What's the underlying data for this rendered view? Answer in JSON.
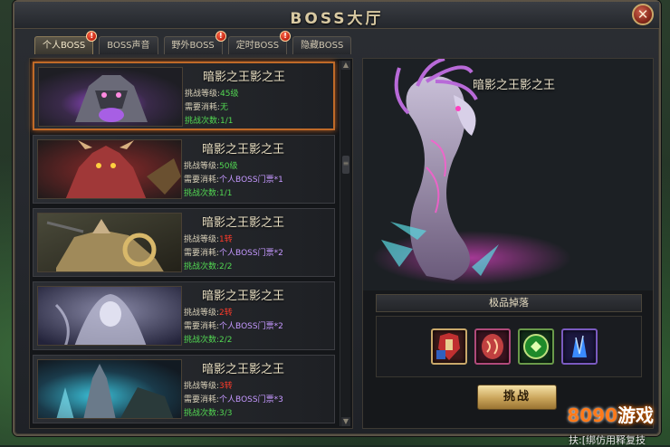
{
  "window": {
    "title": "BOSS大厅",
    "close_glyph": "✕"
  },
  "tabs": [
    {
      "label": "个人BOSS",
      "active": true,
      "badge": "!"
    },
    {
      "label": "BOSS声音",
      "active": false,
      "badge": ""
    },
    {
      "label": "野外BOSS",
      "active": false,
      "badge": "!"
    },
    {
      "label": "定时BOSS",
      "active": false,
      "badge": "!"
    },
    {
      "label": "隐藏BOSS",
      "active": false,
      "badge": ""
    }
  ],
  "boss_list": [
    {
      "name": "暗影之王影之王",
      "level_label": "挑战等级:",
      "level_value": "45级",
      "level_color": "green",
      "cost_label": "需要消耗:",
      "cost_value": "无",
      "cost_color": "green",
      "count_label": "挑战次数:",
      "count_value": "1/1",
      "selected": true,
      "portrait": "purple-demon"
    },
    {
      "name": "暗影之王影之王",
      "level_label": "挑战等级:",
      "level_value": "50级",
      "level_color": "green",
      "cost_label": "需要消耗:",
      "cost_value": "个人BOSS门票*1",
      "cost_color": "purple",
      "count_label": "挑战次数:",
      "count_value": "1/1",
      "selected": false,
      "portrait": "red-demon"
    },
    {
      "name": "暗影之王影之王",
      "level_label": "挑战等级:",
      "level_value": "1转",
      "level_color": "red",
      "cost_label": "需要消耗:",
      "cost_value": "个人BOSS门票*2",
      "cost_color": "purple",
      "count_label": "挑战次数:",
      "count_value": "2/2",
      "selected": false,
      "portrait": "golden-knight"
    },
    {
      "name": "暗影之王影之王",
      "level_label": "挑战等级:",
      "level_value": "2转",
      "level_color": "red",
      "cost_label": "需要消耗:",
      "cost_value": "个人BOSS门票*2",
      "cost_color": "purple",
      "count_label": "挑战次数:",
      "count_value": "2/2",
      "selected": false,
      "portrait": "ghost-lady"
    },
    {
      "name": "暗影之王影之王",
      "level_label": "挑战等级:",
      "level_value": "3转",
      "level_color": "red",
      "cost_label": "需要消耗:",
      "cost_value": "个人BOSS门票*3",
      "cost_color": "purple",
      "count_label": "挑战次数:",
      "count_value": "3/3",
      "selected": false,
      "portrait": "blue-knight"
    }
  ],
  "detail": {
    "boss_name": "暗影之王影之王",
    "drop_header": "极品掉落",
    "drops": [
      {
        "icon": "armor-icon",
        "border": "#c9a86a",
        "bg": "#3a1a1a"
      },
      {
        "icon": "rune-stone-icon",
        "border": "#b04a7a",
        "bg": "#3a1420"
      },
      {
        "icon": "green-orb-icon",
        "border": "#6a9a4a",
        "bg": "#12301a"
      },
      {
        "icon": "blue-crystal-icon",
        "border": "#7a5ac0",
        "bg": "#1c1840"
      }
    ],
    "challenge_label": "挑战"
  },
  "scroll": {
    "up": "▲",
    "down": "▼",
    "thumb": "≡"
  },
  "watermark": {
    "digits": "8090",
    "text": "游戏"
  },
  "bottom_text": "扶:[绑仿用释复技"
}
